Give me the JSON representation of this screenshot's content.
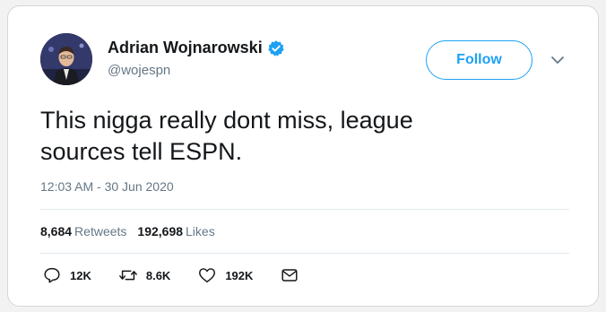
{
  "user": {
    "display_name": "Adrian Wojnarowski",
    "handle": "@wojespn",
    "verified": true
  },
  "header": {
    "follow_label": "Follow"
  },
  "tweet": {
    "text_line1": "This nigga really dont miss, league",
    "text_line2": "sources tell ESPN.",
    "timestamp": "12:03 AM - 30 Jun 2020"
  },
  "stats": {
    "retweets_count": "8,684",
    "retweets_label": "Retweets",
    "likes_count": "192,698",
    "likes_label": "Likes"
  },
  "actions": {
    "reply_count": "12K",
    "retweet_count": "8.6K",
    "like_count": "192K"
  },
  "colors": {
    "accent": "#1da1f2",
    "text_primary": "#14171a",
    "text_secondary": "#657786",
    "divider": "#e1e8ed"
  },
  "icons": [
    "verified-badge-icon",
    "chevron-down-icon",
    "reply-icon",
    "retweet-icon",
    "like-icon",
    "mail-icon"
  ]
}
